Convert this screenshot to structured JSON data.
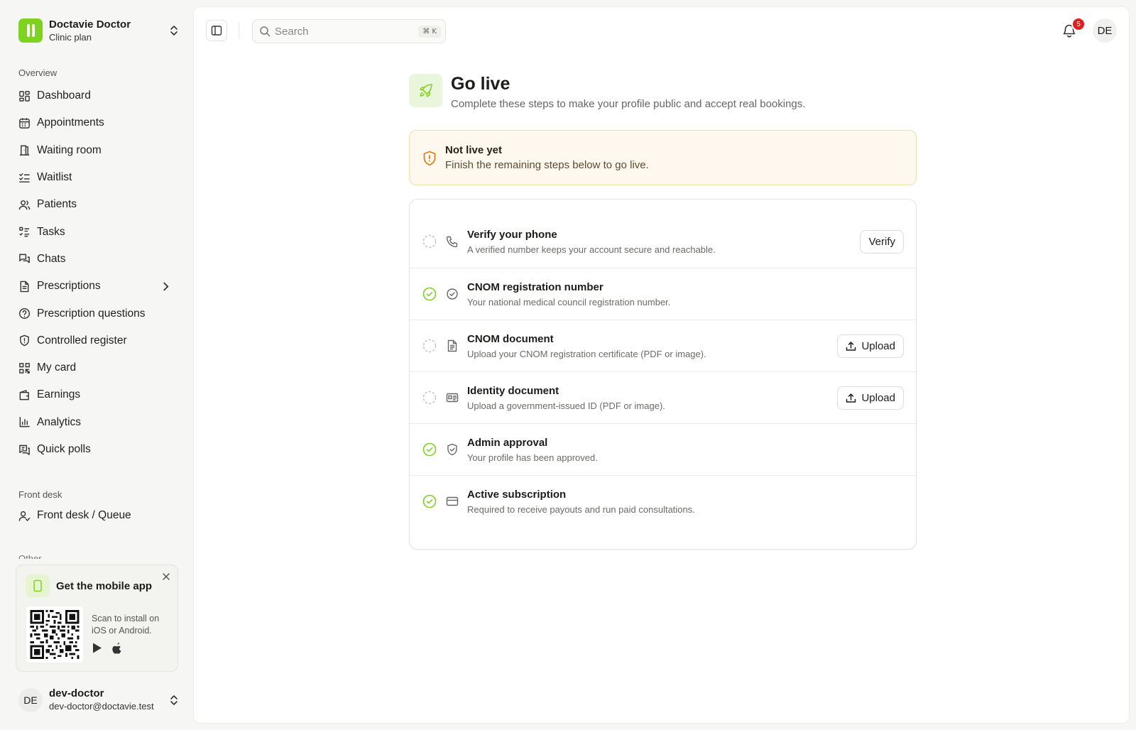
{
  "org": {
    "name": "Doctavie Doctor",
    "plan": "Clinic plan"
  },
  "sidebar": {
    "overview_label": "Overview",
    "items": [
      {
        "label": "Dashboard",
        "icon": "dashboard-icon"
      },
      {
        "label": "Appointments",
        "icon": "calendar-icon"
      },
      {
        "label": "Waiting room",
        "icon": "door-icon"
      },
      {
        "label": "Waitlist",
        "icon": "list-checks-icon"
      },
      {
        "label": "Patients",
        "icon": "users-icon"
      },
      {
        "label": "Tasks",
        "icon": "tasks-icon"
      },
      {
        "label": "Chats",
        "icon": "chats-icon"
      },
      {
        "label": "Prescriptions",
        "icon": "file-icon",
        "has_submenu": true
      },
      {
        "label": "Prescription questions",
        "icon": "help-circle-icon"
      },
      {
        "label": "Controlled register",
        "icon": "shield-alert-icon"
      },
      {
        "label": "My card",
        "icon": "qr-icon"
      },
      {
        "label": "Earnings",
        "icon": "wallet-icon"
      },
      {
        "label": "Analytics",
        "icon": "bar-chart-icon"
      },
      {
        "label": "Quick polls",
        "icon": "poll-icon"
      }
    ],
    "front_desk_label": "Front desk",
    "front_desk_items": [
      {
        "label": "Front desk / Queue",
        "icon": "user-check-icon"
      }
    ],
    "other_label": "Other"
  },
  "mobile_app": {
    "title": "Get the mobile app",
    "scan_text": "Scan to install on iOS or Android."
  },
  "user": {
    "initials": "DE",
    "name": "dev-doctor",
    "email": "dev-doctor@doctavie.test"
  },
  "topbar": {
    "search_placeholder": "Search",
    "shortcut": "⌘ K",
    "notification_count": "5",
    "avatar_initials": "DE"
  },
  "page": {
    "title": "Go live",
    "subtitle": "Complete these steps to make your profile public and accept real bookings."
  },
  "alert": {
    "title": "Not live yet",
    "message": "Finish the remaining steps below to go live."
  },
  "steps": [
    {
      "title": "Verify your phone",
      "description": "A verified number keeps your account secure and reachable.",
      "done": false,
      "icon": "phone-icon",
      "action": "Verify"
    },
    {
      "title": "CNOM registration number",
      "description": "Your national medical council registration number.",
      "done": true,
      "icon": "badge-check-icon",
      "action": ""
    },
    {
      "title": "CNOM document",
      "description": "Upload your CNOM registration certificate (PDF or image).",
      "done": false,
      "icon": "document-icon",
      "action": "Upload"
    },
    {
      "title": "Identity document",
      "description": "Upload a government-issued ID (PDF or image).",
      "done": false,
      "icon": "id-card-icon",
      "action": "Upload"
    },
    {
      "title": "Admin approval",
      "description": "Your profile has been approved.",
      "done": true,
      "icon": "shield-check-icon",
      "action": ""
    },
    {
      "title": "Active subscription",
      "description": "Required to receive payouts and run paid consultations.",
      "done": true,
      "icon": "credit-card-icon",
      "action": ""
    }
  ],
  "colors": {
    "accent": "#7ed321",
    "warning": "#e57a14",
    "danger": "#e21d1d"
  }
}
